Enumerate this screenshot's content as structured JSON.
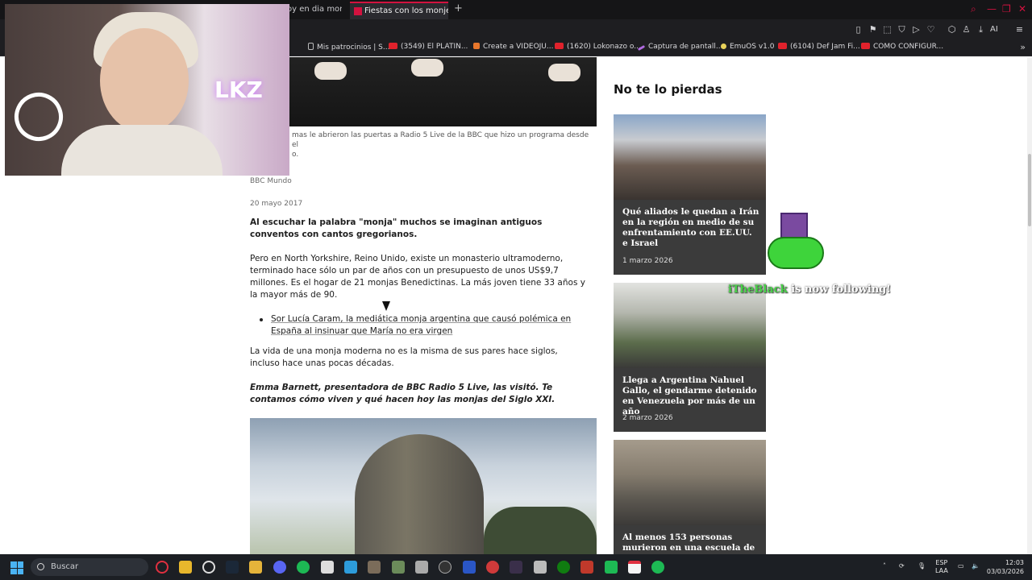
{
  "browser": {
    "tabs": [
      {
        "label": "oy en dia monjas",
        "active": false
      },
      {
        "label": "Fiestas con los monjes e h",
        "active": true
      }
    ],
    "new_tab": "+",
    "toolbar_ai": "AI",
    "bookmarks": [
      {
        "label": "Mis patrocinios | S...",
        "icon": "doc"
      },
      {
        "label": "(3549) El PLATIN...",
        "icon": "yt"
      },
      {
        "label": "Create a VIDEOJU...",
        "icon": "or"
      },
      {
        "label": "(1620) Lokonazo o...",
        "icon": "yt"
      },
      {
        "label": "Captura de pantall...",
        "icon": "pu"
      },
      {
        "label": "EmuOS v1.0",
        "icon": "gear"
      },
      {
        "label": "(6104) Def Jam Fi...",
        "icon": "yt"
      },
      {
        "label": "COMO CONFIGUR...",
        "icon": "yt"
      }
    ]
  },
  "article": {
    "caption": "mas le abrieron las puertas a Radio 5 Live de la BBC que hizo un programa desde el",
    "caption2": "o.",
    "source": "BBC Mundo",
    "date": "20 mayo 2017",
    "lead": "Al escuchar la palabra \"monja\" muchos se imaginan antiguos conventos con cantos gregorianos.",
    "para1": "Pero en North Yorkshire, Reino Unido, existe un monasterio ultramoderno, terminado hace sólo un par de años con un presupuesto de unos US$9,7 millones. Es el hogar de 21 monjas Benedictinas. La más joven tiene 33 años y la mayor más de 90.",
    "related_link": "Sor Lucía Caram, la mediática monja argentina que causó polémica en España al insinuar que María no era virgen",
    "para2": "La vida de una monja moderna no es la misma de sus pares hace siglos, incluso hace unas pocas décadas.",
    "para3": "Emma Barnett, presentadora de BBC Radio 5 Live, las visitó. Te contamos cómo viven y qué hacen hoy las monjas del Siglo XXI."
  },
  "sidebar": {
    "title": "No te lo pierdas",
    "cards": [
      {
        "title": "Qué aliados le quedan a Irán en la región en medio de su enfrentamiento con EE.UU. e Israel",
        "date": "1 marzo 2026"
      },
      {
        "title": "Llega a Argentina Nahuel Gallo, el gendarme detenido en Venezuela por más de un año",
        "date": "2 marzo 2026"
      },
      {
        "title": "Al menos 153 personas murieron en una escuela de",
        "date": ""
      }
    ]
  },
  "overlay": {
    "webcam_neon": "LKZ",
    "follow_name": "iTheBlack",
    "follow_text": " is now following!"
  },
  "taskbar": {
    "search_placeholder": "Buscar",
    "lang": "ESP",
    "lang2": "LAA",
    "time": "12:03",
    "date": "03/03/2026"
  }
}
